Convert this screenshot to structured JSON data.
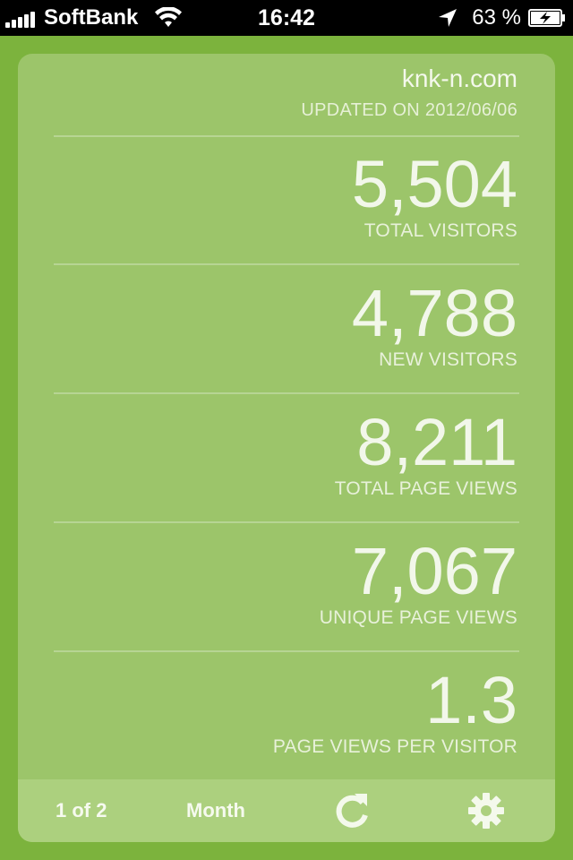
{
  "status_bar": {
    "carrier": "SoftBank",
    "time": "16:42",
    "battery_percent": "63 %"
  },
  "header": {
    "site": "knk-n.com",
    "updated": "UPDATED ON 2012/06/06"
  },
  "metrics": [
    {
      "value": "5,504",
      "label": "TOTAL VISITORS"
    },
    {
      "value": "4,788",
      "label": "NEW VISITORS"
    },
    {
      "value": "8,211",
      "label": "TOTAL PAGE VIEWS"
    },
    {
      "value": "7,067",
      "label": "UNIQUE PAGE VIEWS"
    },
    {
      "value": "1.3",
      "label": "PAGE VIEWS PER VISITOR"
    }
  ],
  "toolbar": {
    "page_indicator": "1 of 2",
    "period": "Month",
    "refresh_icon": "refresh-icon",
    "settings_icon": "gear-icon"
  },
  "colors": {
    "background": "#7cb33d",
    "card": "#9cc56a",
    "toolbar": "#acd07e",
    "text": "#f2f7ea"
  }
}
